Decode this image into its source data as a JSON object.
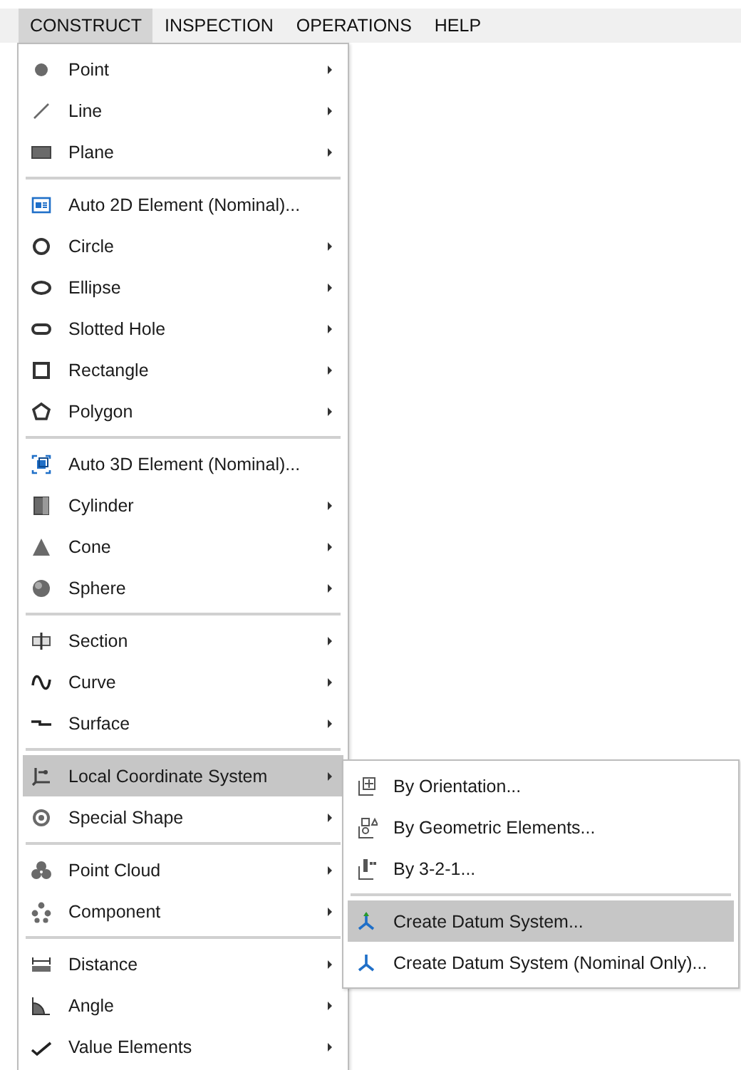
{
  "menubar": [
    {
      "label": "CONSTRUCT",
      "selected": true
    },
    {
      "label": "INSPECTION",
      "selected": false
    },
    {
      "label": "OPERATIONS",
      "selected": false
    },
    {
      "label": "HELP",
      "selected": false
    }
  ],
  "menu": {
    "groups": [
      {
        "items": [
          {
            "label": "Point",
            "submenu": true,
            "selected": false
          },
          {
            "label": "Line",
            "submenu": true,
            "selected": false
          },
          {
            "label": "Plane",
            "submenu": true,
            "selected": false
          }
        ]
      },
      {
        "items": [
          {
            "label": "Auto 2D Element (Nominal)...",
            "submenu": false,
            "selected": false
          },
          {
            "label": "Circle",
            "submenu": true,
            "selected": false
          },
          {
            "label": "Ellipse",
            "submenu": true,
            "selected": false
          },
          {
            "label": "Slotted Hole",
            "submenu": true,
            "selected": false
          },
          {
            "label": "Rectangle",
            "submenu": true,
            "selected": false
          },
          {
            "label": "Polygon",
            "submenu": true,
            "selected": false
          }
        ]
      },
      {
        "items": [
          {
            "label": "Auto 3D Element (Nominal)...",
            "submenu": false,
            "selected": false
          },
          {
            "label": "Cylinder",
            "submenu": true,
            "selected": false
          },
          {
            "label": "Cone",
            "submenu": true,
            "selected": false
          },
          {
            "label": "Sphere",
            "submenu": true,
            "selected": false
          }
        ]
      },
      {
        "items": [
          {
            "label": "Section",
            "submenu": true,
            "selected": false
          },
          {
            "label": "Curve",
            "submenu": true,
            "selected": false
          },
          {
            "label": "Surface",
            "submenu": true,
            "selected": false
          }
        ]
      },
      {
        "items": [
          {
            "label": "Local Coordinate System",
            "submenu": true,
            "selected": true
          },
          {
            "label": "Special Shape",
            "submenu": true,
            "selected": false
          }
        ]
      },
      {
        "items": [
          {
            "label": "Point Cloud",
            "submenu": true,
            "selected": false
          },
          {
            "label": "Component",
            "submenu": true,
            "selected": false
          }
        ]
      },
      {
        "items": [
          {
            "label": "Distance",
            "submenu": true,
            "selected": false
          },
          {
            "label": "Angle",
            "submenu": true,
            "selected": false
          },
          {
            "label": "Value Elements",
            "submenu": true,
            "selected": false
          }
        ]
      }
    ]
  },
  "submenu": {
    "groups": [
      {
        "items": [
          {
            "label": "By Orientation...",
            "selected": false
          },
          {
            "label": "By Geometric Elements...",
            "selected": false
          },
          {
            "label": "By 3-2-1...",
            "selected": false
          }
        ]
      },
      {
        "items": [
          {
            "label": "Create Datum System...",
            "selected": true
          },
          {
            "label": "Create Datum System (Nominal Only)...",
            "selected": false
          }
        ]
      }
    ]
  }
}
